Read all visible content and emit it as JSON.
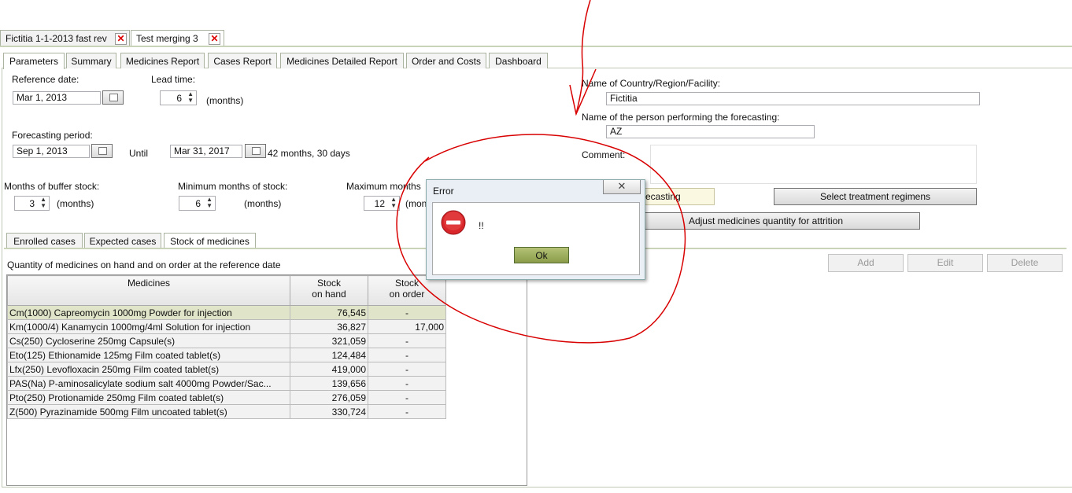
{
  "doc_tabs": [
    {
      "label": "Fictitia 1-1-2013 fast rev"
    },
    {
      "label": "Test merging 3"
    }
  ],
  "param_tabs": [
    "Parameters",
    "Summary",
    "Medicines Report",
    "Cases Report",
    "Medicines Detailed Report",
    "Order and Costs",
    "Dashboard"
  ],
  "form": {
    "reference_date_label": "Reference date:",
    "reference_date": "Mar 1, 2013",
    "lead_time_label": "Lead time:",
    "lead_time": "6",
    "months_unit": "(months)",
    "forecasting_period_label": "Forecasting period:",
    "period_start": "Sep 1, 2013",
    "until_label": "Until",
    "period_end": "Mar 31, 2017",
    "period_summary": "42 months, 30 days",
    "buffer_label": "Months of buffer stock:",
    "buffer_value": "3",
    "min_label": "Minimum months of stock:",
    "min_value": "6",
    "max_label": "Maximum months",
    "max_value": "12",
    "max_unit_partial": "(mon",
    "country_label": "Name of Country/Region/Facility:",
    "country_value": "Fictitia",
    "person_label": "Name of the person performing the forecasting:",
    "person_value": "AZ",
    "comment_label": "Comment:"
  },
  "buttons": {
    "forecasting_partial": "recasting",
    "select_regimens": "Select treatment regimens",
    "adjust_attrition": "Adjust medicines quantity for attrition",
    "add": "Add",
    "edit": "Edit",
    "delete": "Delete"
  },
  "sub_tabs": [
    "Enrolled cases",
    "Expected cases",
    "Stock of medicines"
  ],
  "stock": {
    "caption": "Quantity of medicines on hand and on order at the reference date",
    "headers": {
      "medicines": "Medicines",
      "on_hand_1": "Stock",
      "on_hand_2": "on hand",
      "on_order_1": "Stock",
      "on_order_2": "on order"
    },
    "rows": [
      {
        "name": "Cm(1000)  Capreomycin  1000mg  Powder for injection",
        "on_hand": "76,545",
        "on_order": "-"
      },
      {
        "name": "Km(1000/4)  Kanamycin  1000mg/4ml  Solution for injection",
        "on_hand": "36,827",
        "on_order": "17,000"
      },
      {
        "name": "Cs(250)  Cycloserine  250mg  Capsule(s)",
        "on_hand": "321,059",
        "on_order": "-"
      },
      {
        "name": "Eto(125)  Ethionamide  125mg  Film coated tablet(s)",
        "on_hand": "124,484",
        "on_order": "-"
      },
      {
        "name": "Lfx(250)  Levofloxacin  250mg  Film coated tablet(s)",
        "on_hand": "419,000",
        "on_order": "-"
      },
      {
        "name": "PAS(Na)  P-aminosalicylate sodium salt  4000mg  Powder/Sac...",
        "on_hand": "139,656",
        "on_order": "-"
      },
      {
        "name": "Pto(250)  Protionamide   250mg  Film coated tablet(s)",
        "on_hand": "276,059",
        "on_order": "-"
      },
      {
        "name": "Z(500)  Pyrazinamide  500mg  Film uncoated tablet(s)",
        "on_hand": "330,724",
        "on_order": "-"
      }
    ]
  },
  "dialog": {
    "title": "Error",
    "message": "!!",
    "ok_label": "Ok",
    "close_glyph": "✕"
  },
  "colors": {
    "annotation": "#d80000",
    "error_icon": "#d9262a",
    "ok_button": "#9aab55"
  }
}
